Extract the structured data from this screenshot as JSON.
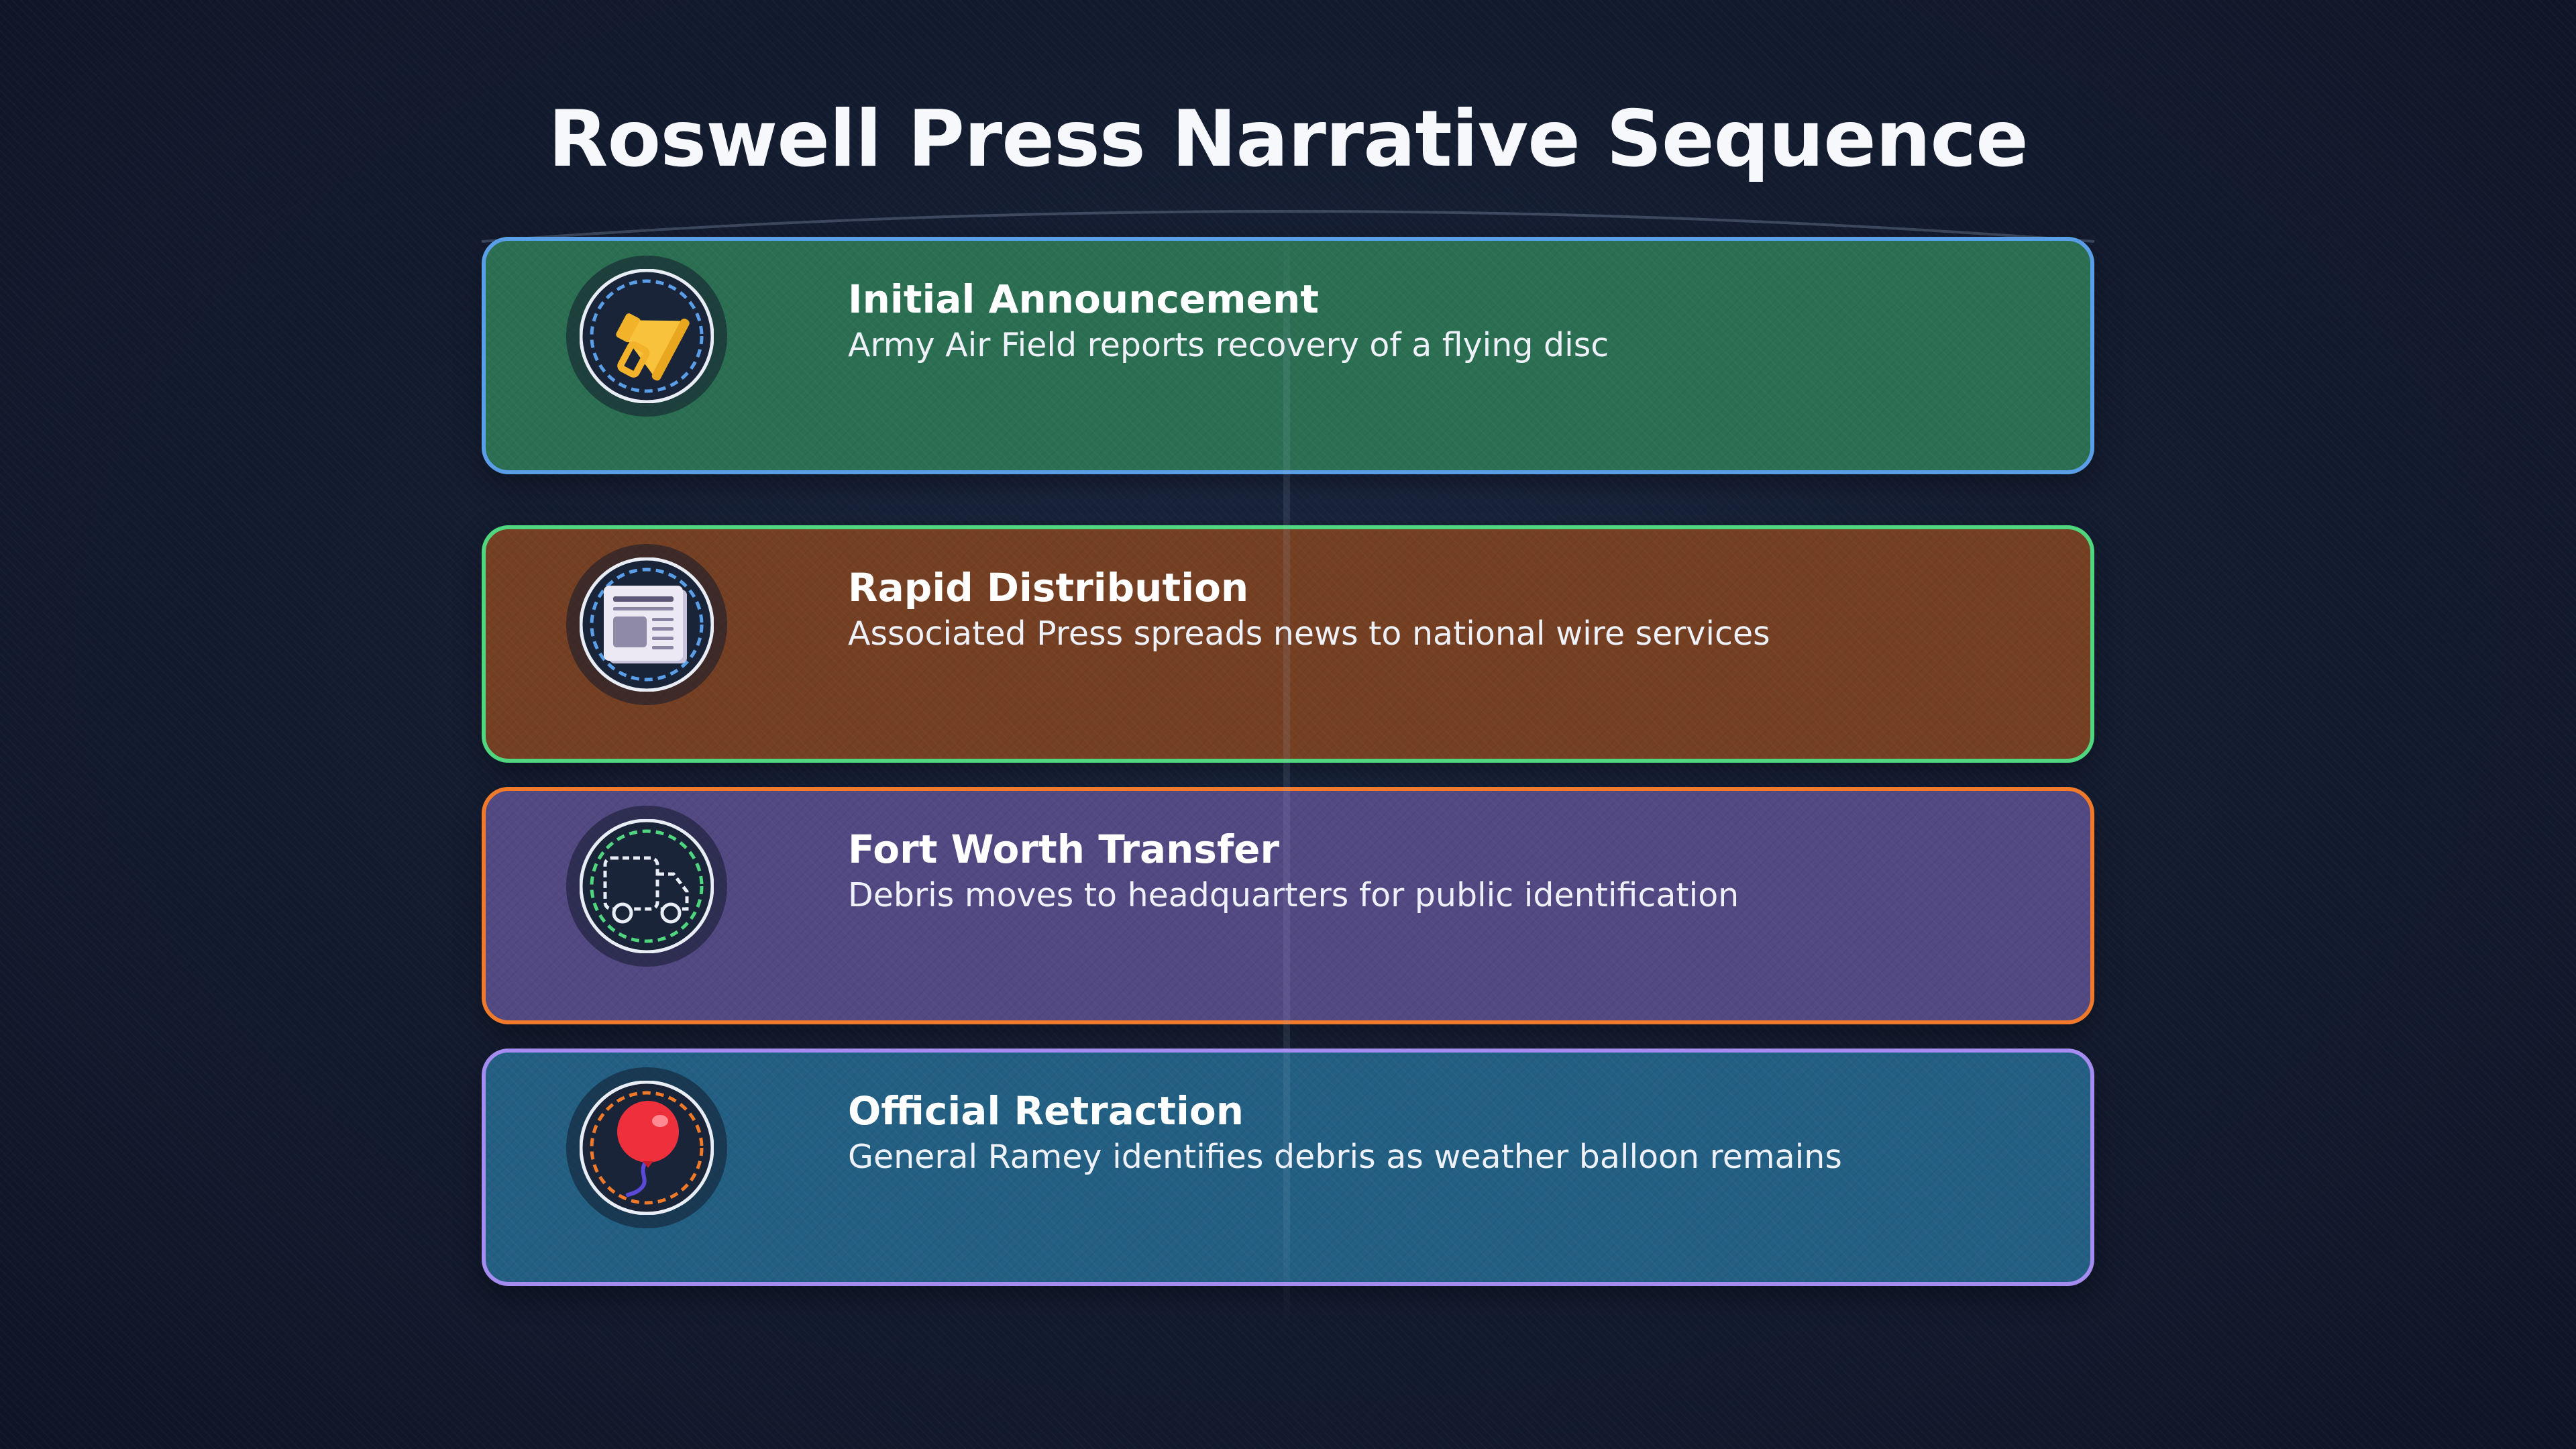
{
  "title": "Roswell Press Narrative Sequence",
  "steps": [
    {
      "title": "Initial Announcement",
      "description": "Army Air Field reports recovery of a flying disc",
      "icon": "megaphone-icon",
      "fill_color": "#2b6f52",
      "border_color": "#5b9ee8"
    },
    {
      "title": "Rapid Distribution",
      "description": "Associated Press spreads news to national wire services",
      "icon": "newspaper-icon",
      "fill_color": "#743f23",
      "border_color": "#4fd67f"
    },
    {
      "title": "Fort Worth Transfer",
      "description": "Debris moves to headquarters for public identification",
      "icon": "truck-icon",
      "fill_color": "#524882",
      "border_color": "#f07a2a"
    },
    {
      "title": "Official Retraction",
      "description": "General Ramey identifies debris as weather balloon remains",
      "icon": "balloon-icon",
      "fill_color": "#225f82",
      "border_color": "#a58cf0"
    }
  ]
}
